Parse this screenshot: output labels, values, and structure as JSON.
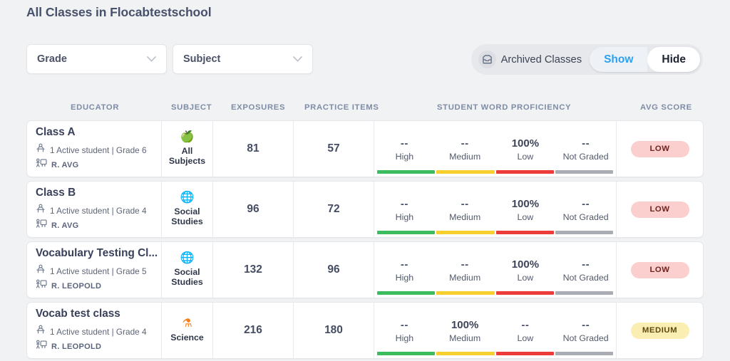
{
  "header": {
    "title": "All Classes in Flocabtestschool"
  },
  "filters": {
    "grade": {
      "label": "Grade",
      "icon": "chevron-down-icon"
    },
    "subject": {
      "label": "Subject",
      "icon": "chevron-down-icon"
    }
  },
  "archived": {
    "icon": "archive-tray-icon",
    "label": "Archived Classes",
    "show_label": "Show",
    "hide_label": "Hide",
    "selected": "Hide"
  },
  "table": {
    "columns": {
      "educator": "EDUCATOR",
      "subject": "SUBJECT",
      "exposures": "EXPOSURES",
      "practice_items": "PRACTICE ITEMS",
      "proficiency": "STUDENT WORD PROFICIENCY",
      "avg_score": "AVG SCORE"
    },
    "proficiency_keys": [
      "High",
      "Medium",
      "Low",
      "Not Graded"
    ],
    "bar_colors": [
      "#3cbc5c",
      "#f7d02f",
      "#ec3c3a",
      "#a9adb3"
    ],
    "rows": [
      {
        "class_name": "Class A",
        "student_icon": "student-desk-icon",
        "students_meta": "1 Active student | Grade 6",
        "teacher_icon": "teacher-board-icon",
        "teacher": "R. AVG",
        "subject_icon": "apple-icon",
        "subject_glyph": "🍏",
        "subject_color": "#3fae49",
        "subject_label": "All\nSubjects",
        "exposures": "81",
        "practice_items": "57",
        "proficiency_values": [
          "--",
          "--",
          "100%",
          "--"
        ],
        "avg_score": "LOW",
        "avg_score_level": "low"
      },
      {
        "class_name": "Class B",
        "student_icon": "student-desk-icon",
        "students_meta": "1 Active student | Grade 4",
        "teacher_icon": "teacher-board-icon",
        "teacher": "R. AVG",
        "subject_icon": "globe-icon",
        "subject_glyph": "🌐",
        "subject_color": "#4b2d83",
        "subject_label": "Social\nStudies",
        "exposures": "96",
        "practice_items": "72",
        "proficiency_values": [
          "--",
          "--",
          "100%",
          "--"
        ],
        "avg_score": "LOW",
        "avg_score_level": "low"
      },
      {
        "class_name": "Vocabulary Testing Cl...",
        "student_icon": "student-desk-icon",
        "students_meta": "1 Active student | Grade 5",
        "teacher_icon": "teacher-board-icon",
        "teacher": "R. LEOPOLD",
        "subject_icon": "globe-icon",
        "subject_glyph": "🌐",
        "subject_color": "#4b2d83",
        "subject_label": "Social\nStudies",
        "exposures": "132",
        "practice_items": "96",
        "proficiency_values": [
          "--",
          "--",
          "100%",
          "--"
        ],
        "avg_score": "LOW",
        "avg_score_level": "low"
      },
      {
        "class_name": "Vocab test class",
        "student_icon": "student-desk-icon",
        "students_meta": "1 Active student | Grade 4",
        "teacher_icon": "teacher-board-icon",
        "teacher": "R. LEOPOLD",
        "subject_icon": "flask-icon",
        "subject_glyph": "⚗",
        "subject_color": "#f58220",
        "subject_label": "Science",
        "exposures": "216",
        "practice_items": "180",
        "proficiency_values": [
          "--",
          "100%",
          "--",
          "--"
        ],
        "avg_score": "MEDIUM",
        "avg_score_level": "medium"
      }
    ]
  }
}
